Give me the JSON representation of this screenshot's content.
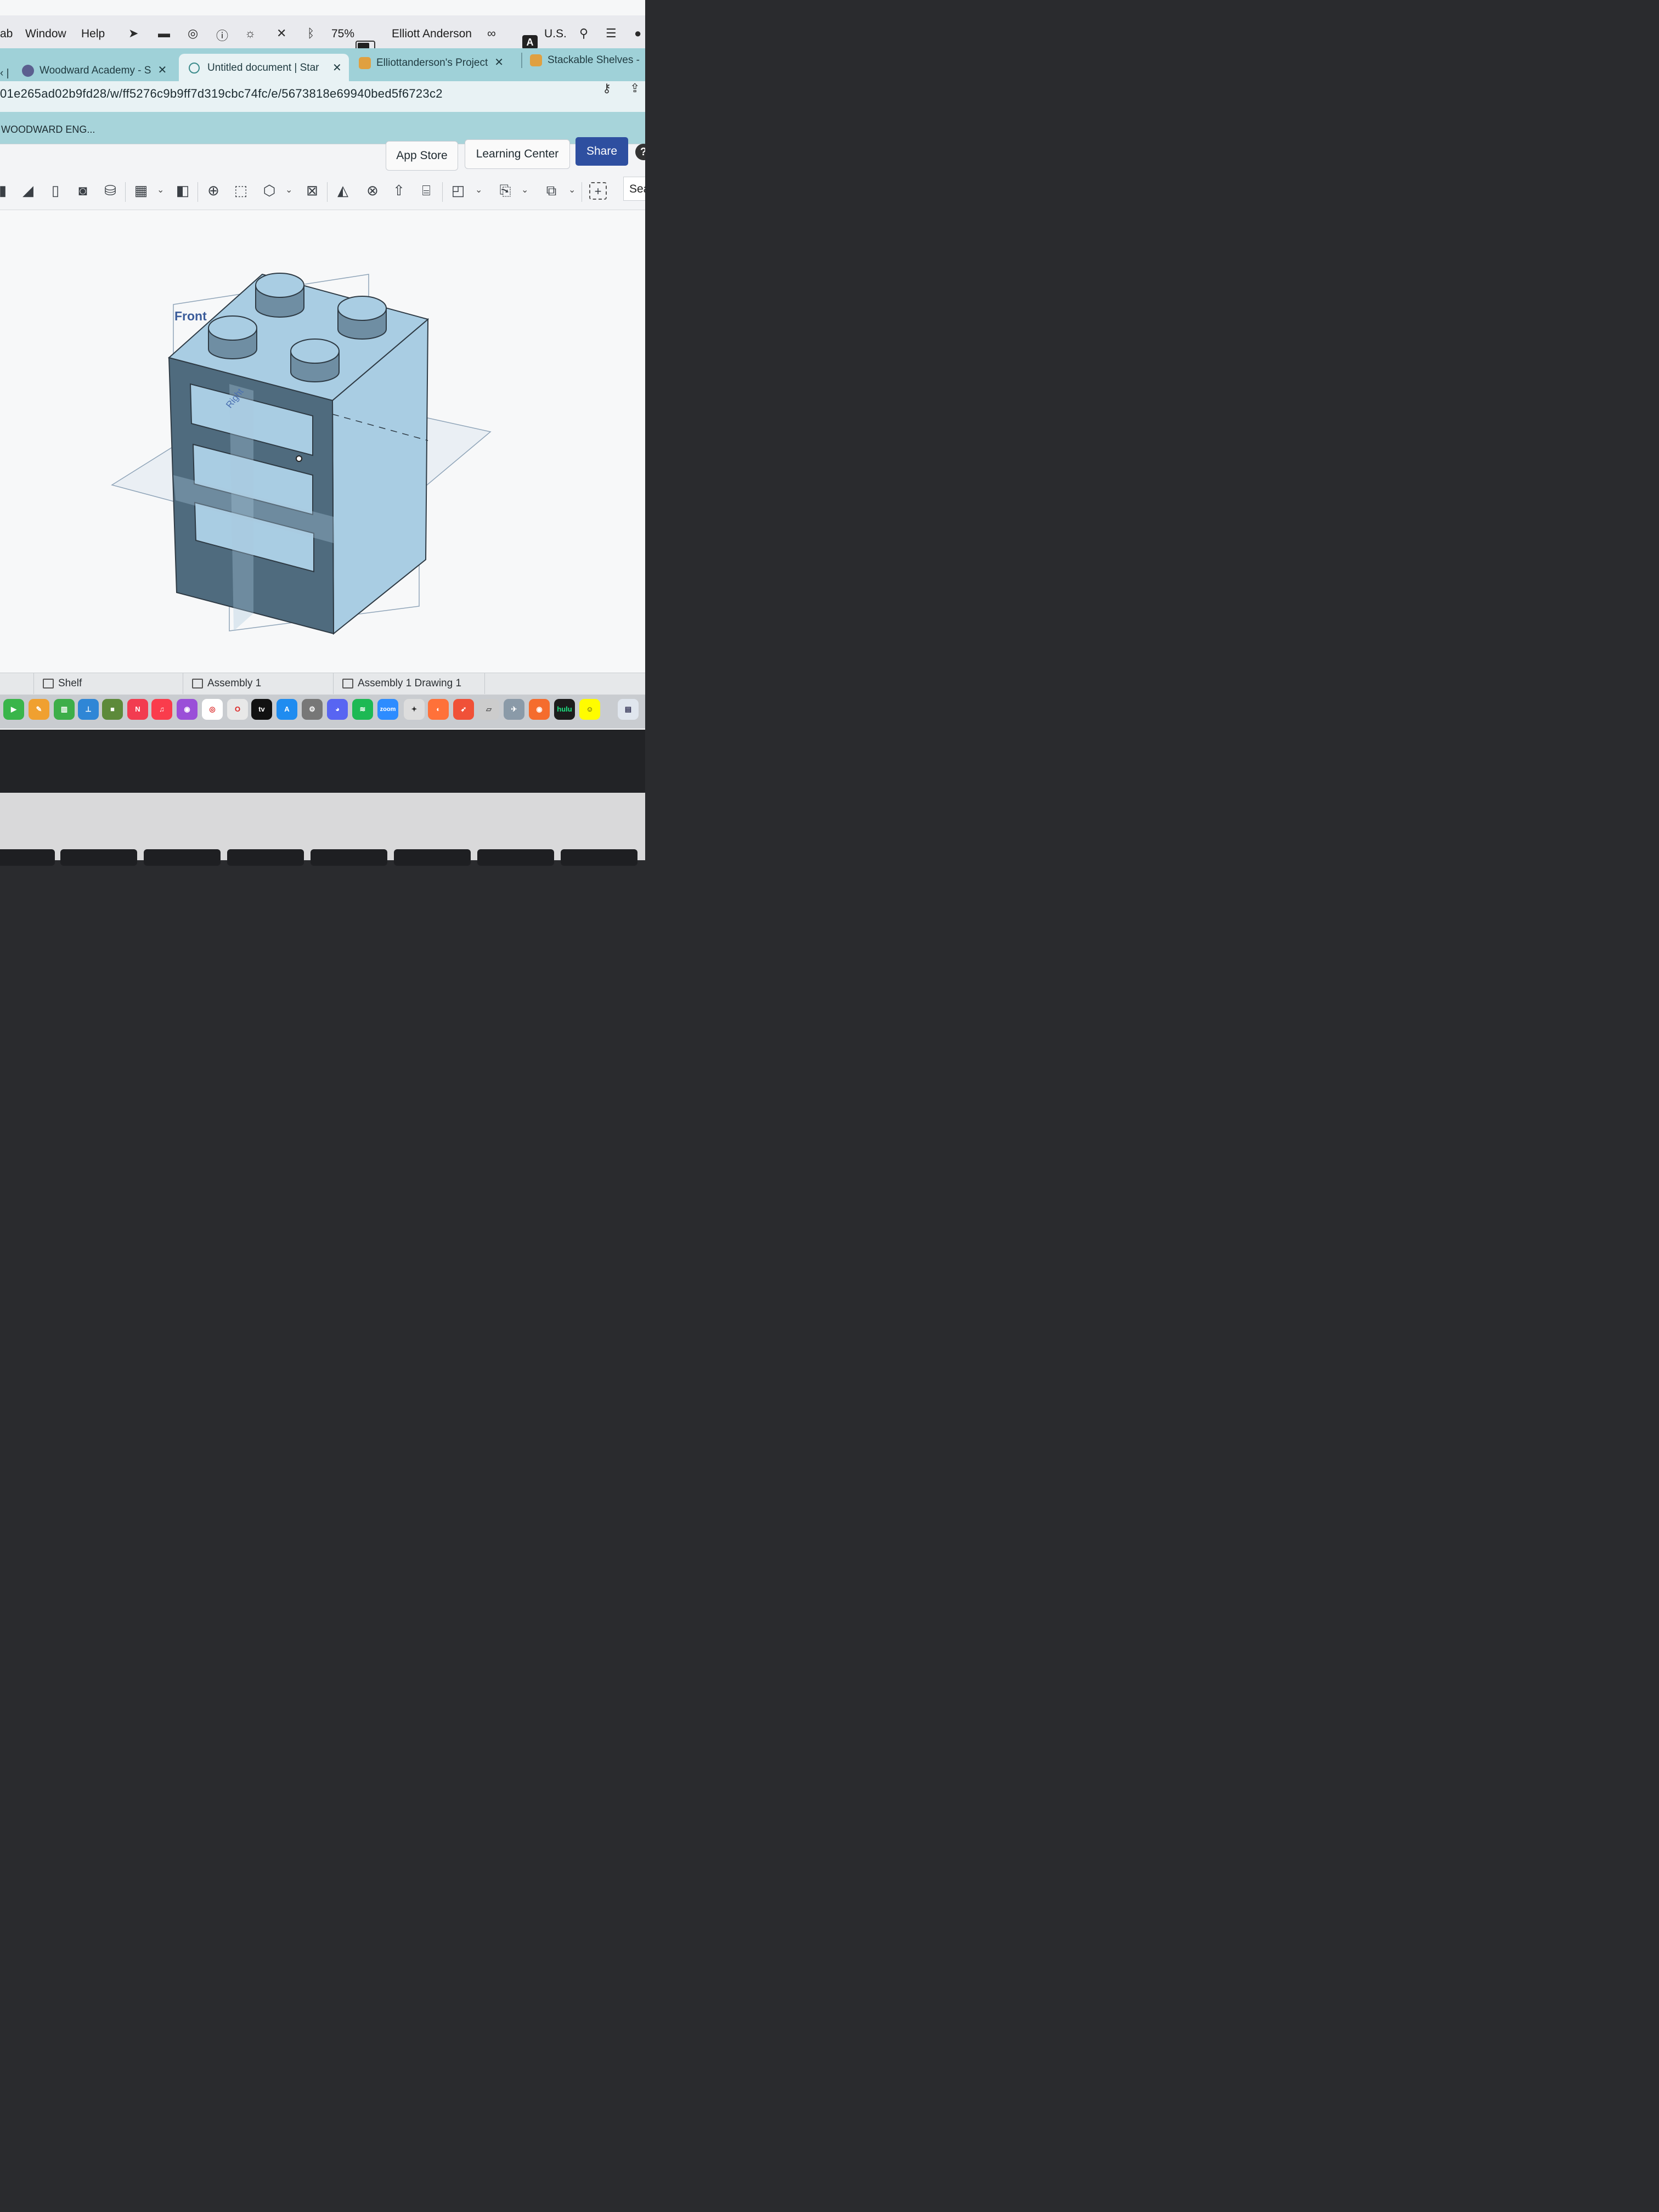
{
  "menubar": {
    "app_partial": "ab",
    "window": "Window",
    "help": "Help",
    "battery_percent": "75%",
    "battery_level": 0.75,
    "user_name": "Elliott Anderson",
    "input_source_badge": "A",
    "input_source": "U.S.",
    "status_icons": [
      "location-icon",
      "bed-icon",
      "airdrop-icon",
      "accessibility-icon",
      "brightness-icon",
      "mute-icon",
      "bluetooth-icon",
      "battery-icon",
      "link-icon",
      "search-icon",
      "control-center-icon",
      "siri-icon"
    ]
  },
  "browser": {
    "tabs": [
      {
        "label": "Woodward Academy - S",
        "icon": "globe-icon",
        "active": false
      },
      {
        "label": "Untitled document | Star",
        "icon": "onshape-icon",
        "active": true
      },
      {
        "label": "Elliottanderson's Project",
        "icon": "scratch-icon",
        "active": false
      },
      {
        "label": "Stackable Shelves -",
        "icon": "scratch-icon",
        "active": false
      }
    ],
    "url": "01e265ad02b9fd28/w/ff5276c9b9ff7d319cbc74fc/e/5673818e69940bed5f6723c2",
    "bookmark": "WOODWARD ENG..."
  },
  "app_header": {
    "app_store": "App Store",
    "learning_center": "Learning Center",
    "share": "Share",
    "help_glyph": "?"
  },
  "toolbar": {
    "search_partial": "Sea"
  },
  "viewport": {
    "plane_labels": {
      "front": "Front",
      "right": "Right"
    }
  },
  "bottom_tabs": [
    {
      "label": "Shelf"
    },
    {
      "label": "Assembly 1"
    },
    {
      "label": "Assembly 1 Drawing 1"
    }
  ],
  "dock": {
    "apps": [
      "facetime-icon",
      "pages-icon",
      "numbers-icon",
      "keynote-icon",
      "minecraft-icon",
      "news-icon",
      "music-icon",
      "podcasts-icon",
      "chrome-icon",
      "opera-icon",
      "appletv-icon",
      "appstore-icon",
      "settings-icon",
      "discord-icon",
      "spotify-icon",
      "zoom-icon",
      "game-icon",
      "firefox-icon",
      "swift-icon",
      "notes-icon",
      "flight-icon",
      "origin-icon",
      "hulu-icon",
      "snapchat-icon",
      "preview-icon"
    ],
    "appletv_label": "tv",
    "zoom_label": "zoom",
    "hulu_label": "hulu"
  },
  "colors": {
    "tab_strip": "#9fd1d8",
    "share_button": "#2e4fa0",
    "model_face": "#a9cde3",
    "model_dark": "#4f6b7e"
  }
}
